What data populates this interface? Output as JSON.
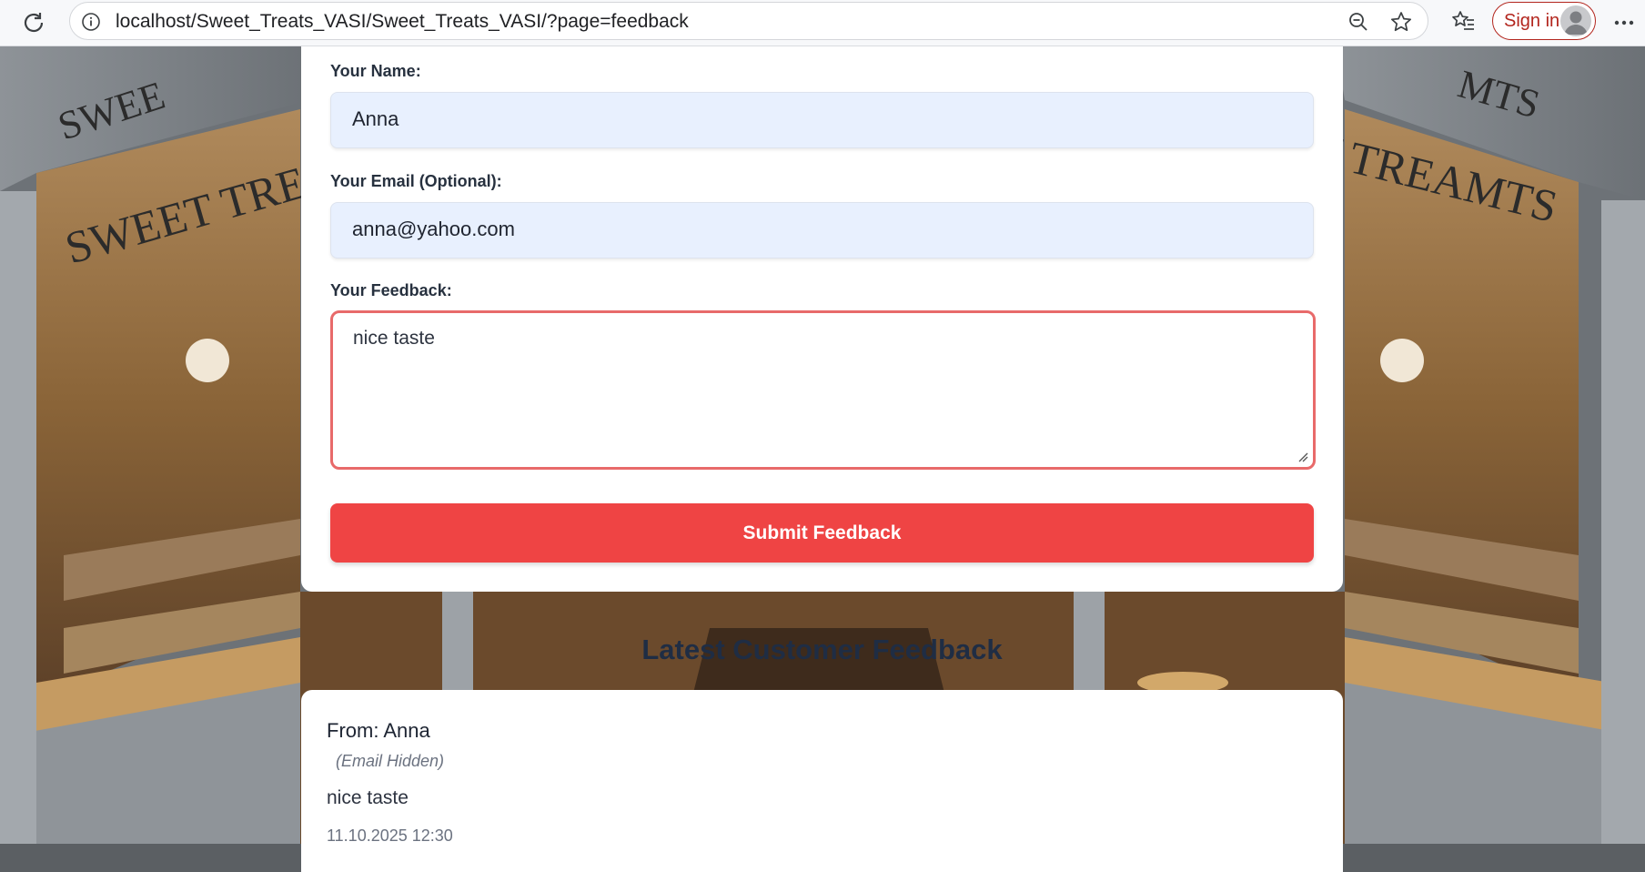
{
  "browser": {
    "url": "localhost/Sweet_Treats_VASI/Sweet_Treats_VASI/?page=feedback",
    "sign_in_label": "Sign in"
  },
  "background": {
    "sign_left_top": "SWEE",
    "sign_left": "SWEET TREAM",
    "sign_right": "T TREAMTS",
    "sign_right_top": "MTS"
  },
  "form": {
    "name_label": "Your Name:",
    "name_value": "Anna",
    "email_label": "Your Email (Optional):",
    "email_value": "anna@yahoo.com",
    "feedback_label": "Your Feedback:",
    "feedback_value": "nice taste",
    "submit_label": "Submit Feedback"
  },
  "latest": {
    "title": "Latest Customer Feedback",
    "entries": [
      {
        "from": "From: Anna",
        "email_note": "(Email Hidden)",
        "message": "nice taste",
        "date": "11.10.2025 12:30"
      }
    ]
  },
  "colors": {
    "accent": "#ef4444",
    "input_bg": "#e8f0fe",
    "focus_border": "#e86a6a",
    "heading": "#1f2d44"
  },
  "icons": [
    "reload-icon",
    "info-icon",
    "zoom-out-icon",
    "star-icon",
    "favorites-icon",
    "avatar",
    "more-icon"
  ]
}
